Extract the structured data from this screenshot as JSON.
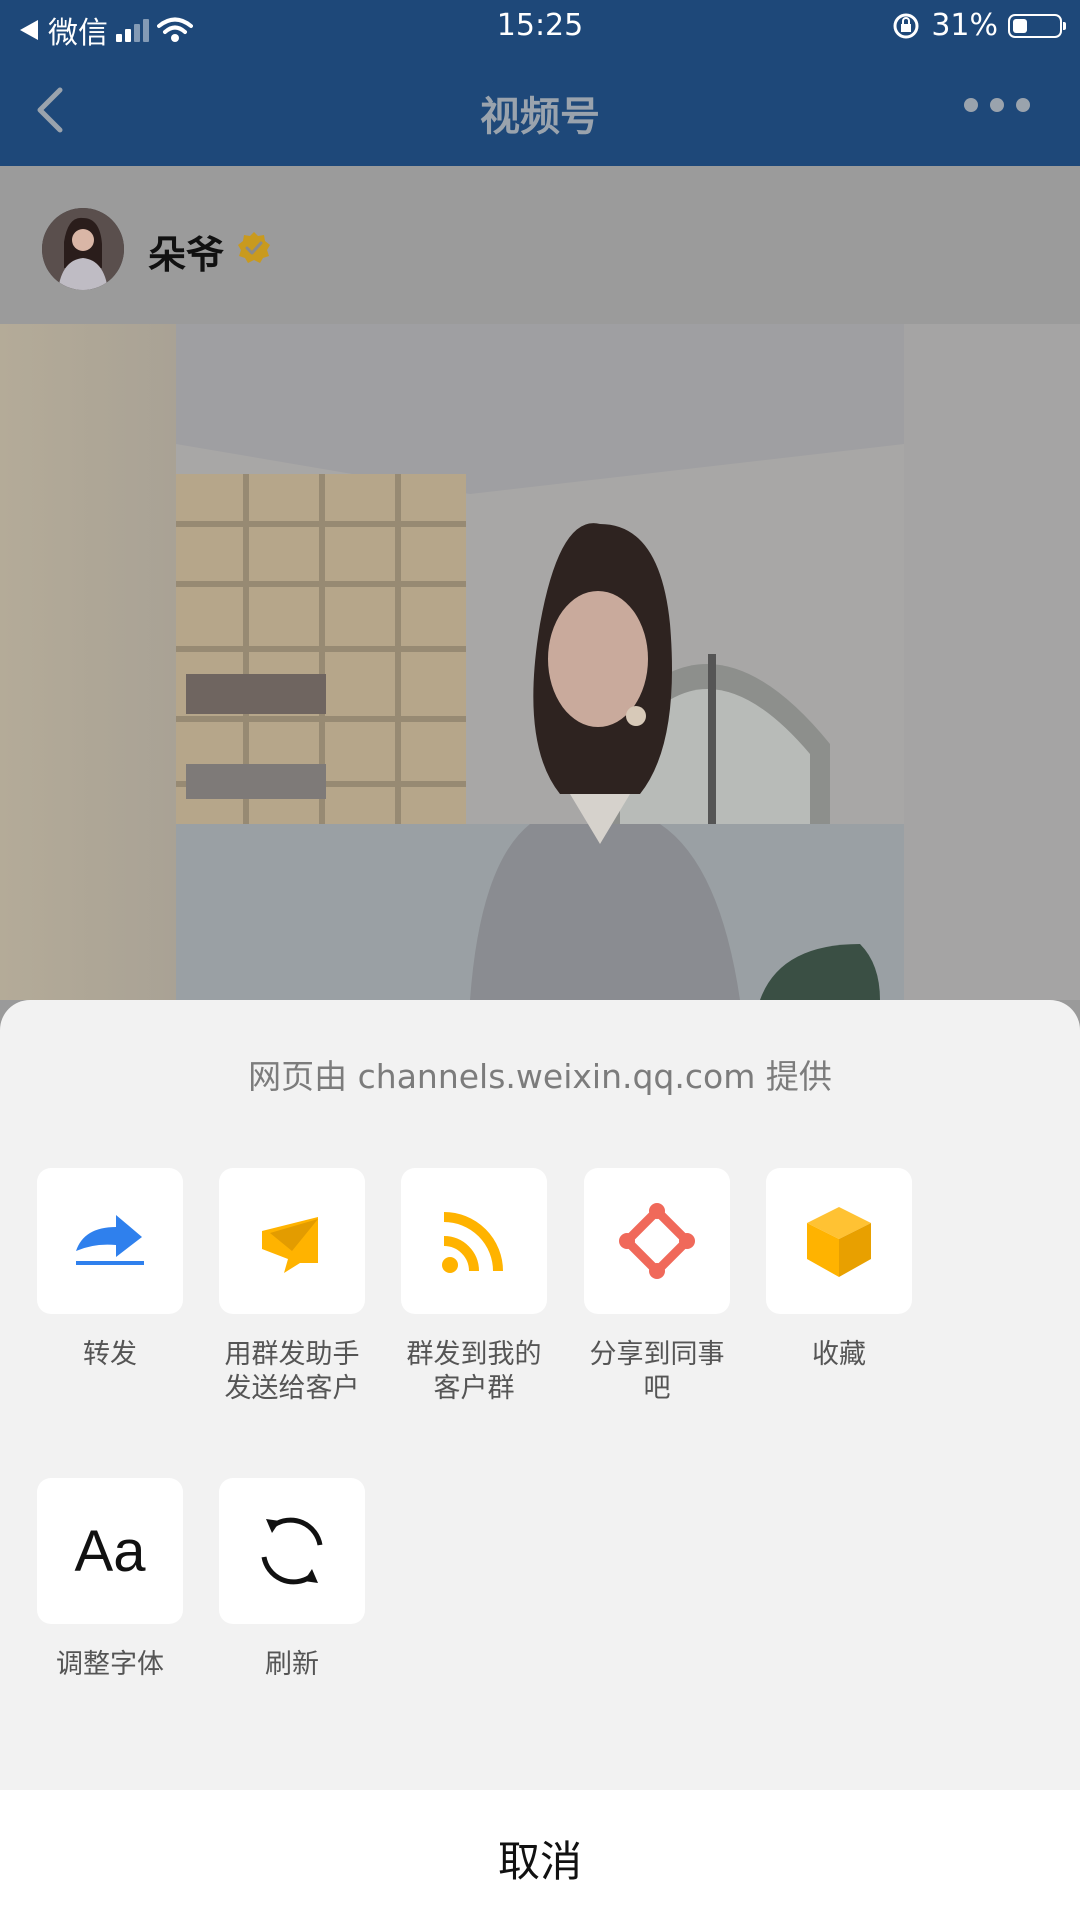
{
  "status_bar": {
    "back_app": "微信",
    "time": "15:25",
    "battery_text": "31%",
    "battery_level": 0.31
  },
  "nav": {
    "title": "视频号"
  },
  "author": {
    "name": "朵爷"
  },
  "share_sheet": {
    "provider_text": "网页由 channels.weixin.qq.com 提供",
    "actions": [
      {
        "label": "转发",
        "icon": "forward-icon"
      },
      {
        "label": "用群发助手发送给客户",
        "icon": "send-icon"
      },
      {
        "label": "群发到我的客户群",
        "icon": "rss-icon"
      },
      {
        "label": "分享到同事吧",
        "icon": "colleague-share-icon"
      },
      {
        "label": "收藏",
        "icon": "cube-icon"
      },
      {
        "label": "调整字体",
        "icon": "font-size-icon",
        "glyph": "Aa"
      },
      {
        "label": "刷新",
        "icon": "refresh-icon"
      }
    ],
    "cancel_label": "取消"
  },
  "colors": {
    "nav_bg": "#1e4879",
    "sheet_bg": "#f2f2f2",
    "accent_blue": "#2f80ed",
    "accent_orange": "#ffb300",
    "accent_coral": "#f0695a"
  }
}
